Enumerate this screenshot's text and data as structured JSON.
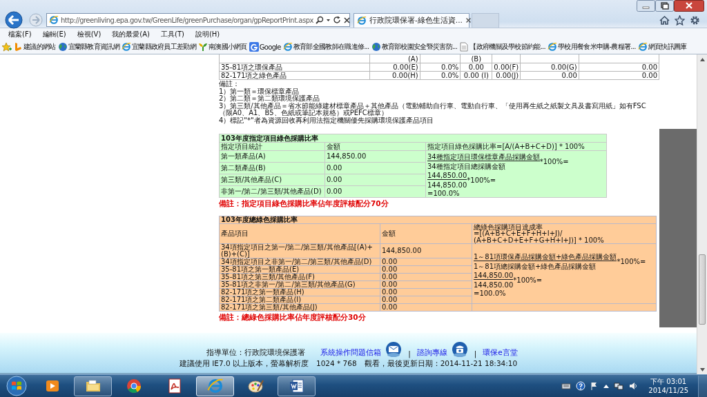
{
  "browser": {
    "forward": {
      "disabled": true
    },
    "address": "http://greenliving.epa.gov.tw/GreenLife/greenPurchase/organ/gpReportPrint.aspx",
    "tab": {
      "title": "行政院環保署-綠色生活資...",
      "selected": true
    },
    "menu": [
      "檔案(F)",
      "編輯(E)",
      "檢視(V)",
      "我的最愛(A)",
      "工具(T)",
      "說明(H)"
    ],
    "favorites": [
      {
        "label": "建議的網站",
        "kind": "bing"
      },
      {
        "label": "宜蘭縣教育資訊網",
        "kind": "globe"
      },
      {
        "label": "宜蘭縣政府員工差勤網",
        "kind": "ie"
      },
      {
        "label": "南澳國小網頁",
        "kind": "sprout"
      },
      {
        "label": "Google",
        "kind": "google"
      },
      {
        "label": "教育部全國教師在職進修...",
        "kind": "ie"
      },
      {
        "label": "教育部校園安全暨災害防...",
        "kind": "globe"
      },
      {
        "label": "【政府機關及學校節約能...",
        "kind": "doc"
      },
      {
        "label": "學校用餐食米申購-農糧署...",
        "kind": "ie"
      },
      {
        "label": "網頁快訊圖庫",
        "kind": "ie"
      }
    ]
  },
  "report": {
    "summary_table": {
      "partial_row": {
        "column_2": "(A)",
        "column_4": "(B)"
      },
      "rows": [
        {
          "cells": [
            "35-81項之環保產品",
            "0.00(E)",
            "0.0%",
            "0.00",
            "0.00(F)",
            "0.00(G)",
            "0.00"
          ]
        },
        {
          "cells": [
            "82-171項之綠色產品",
            "0.00(H)",
            "0.0%",
            "0.00 (I)",
            "0.00(J)",
            "0.00",
            "0.00"
          ]
        }
      ]
    },
    "notes": {
      "title": "備註：",
      "items": [
        "1）第一類＝環保標章產品",
        "2）第二類＝第二類環境保護產品",
        "3）第三類/其他產品＝省水節能綠建材標章產品＋其他產品（電動輔助自行車、電動自行車、「使用再生紙之紙製文具及書寫用紙」如有FSC（限A0、A1、B5、色紙或筆記本規格）或PEFC標章）",
        "4）標記\"*\"者為資源回收再利用法指定機關優先採購環境保護產品項目"
      ]
    },
    "designated": {
      "title": "103年度指定項目綠色採購比率",
      "headers": [
        "指定項目統計",
        "金額",
        "指定項目綠色採購比率=[A/(A+B+C+D)] * 100%"
      ],
      "rows": [
        {
          "label": "第一類產品(A)",
          "amount": "144,850.00"
        },
        {
          "label": "第二類產品(B)",
          "amount": "0.00"
        },
        {
          "label": "第三類/其他產品(C)",
          "amount": "0.00"
        },
        {
          "label": "非第一/第二/第三類/其他產品(D)",
          "amount": "0.00"
        }
      ],
      "formula": {
        "numerator": "34種指定項目環保標章產品採購金額",
        "denominator": "34種指定項目總採購金額",
        "factor": "*100%=",
        "value_numerator": "144,850.00",
        "value_denominator": "144,850.00",
        "value_factor": "*100%=",
        "result": "=100.0%"
      },
      "remark": "備註：指定項目綠色採購比率佔年度評核配分70分"
    },
    "overall": {
      "title": "103年度總綠色採購比率",
      "headers": [
        "產品項目",
        "金額"
      ],
      "formula_header": [
        "總綠色採購項目達成率",
        "=[(A+B+C+E+F+H+I+J)/",
        "(A+B+C+D+E+F+G+H+I+J)] * 100%"
      ],
      "rows": [
        {
          "label": "34項指定項目之第一/第二/第三類/其他產品[(A)+(B)+(C)]",
          "amount": "144,850.00"
        },
        {
          "label": "34項指定項目之非第一/第二/第三類/其他產品(D)",
          "amount": "0.00"
        },
        {
          "label": "35-81項之第一類產品(E)",
          "amount": "0.00"
        },
        {
          "label": "35-81項之第三類/其他產品(F)",
          "amount": "0.00"
        },
        {
          "label": "35-81項之非第一/第二/第三類/其他產品(G)",
          "amount": "0.00"
        },
        {
          "label": "82-171項之第一類產品(H)",
          "amount": "0.00"
        },
        {
          "label": "82-171項之第二類產品(I)",
          "amount": "0.00"
        },
        {
          "label": "82-171項之第三類/其他產品(J)",
          "amount": "0.00"
        }
      ],
      "formula": {
        "numerator": "1～81項環保產品採購金額+綠色產品採購金額",
        "denominator": "1～81項總採購金額+綠色產品採購金額",
        "factor": "*100%=",
        "value_numerator": "144,850.00",
        "value_denominator": "144,850.00",
        "value_factor": "*100%=",
        "result": "=100.0%"
      },
      "remark": "備註：總綠色採購比率佔年度評核配分30分"
    }
  },
  "footer": {
    "line1": [
      {
        "kind": "text",
        "label": "指導單位：行政院環境保護署"
      },
      {
        "kind": "mail-link",
        "label": "系統操作問題信箱"
      },
      {
        "kind": "separator",
        "label": "|"
      },
      {
        "kind": "phone-link",
        "label": "諮詢專線"
      },
      {
        "kind": "separator",
        "label": "|"
      },
      {
        "kind": "link",
        "label": "環保e言堂"
      }
    ],
    "line2": "建議使用 IE7.0 以上版本，螢幕解析度　1024 * 768　觀看，最後更新日期：2014-11-21 18:34:10"
  },
  "taskbar": {
    "apps": [
      {
        "kind": "media",
        "open": false,
        "selected": false
      },
      {
        "kind": "folder",
        "open": true,
        "selected": false
      },
      {
        "kind": "chrome",
        "open": false,
        "selected": false
      },
      {
        "kind": "pdf",
        "open": false,
        "selected": false
      },
      {
        "kind": "ie",
        "open": true,
        "selected": true
      },
      {
        "kind": "paint",
        "open": false,
        "selected": false
      },
      {
        "kind": "word",
        "open": true,
        "selected": false
      }
    ],
    "time": "下午 03:01",
    "date": "2014/11/25"
  }
}
